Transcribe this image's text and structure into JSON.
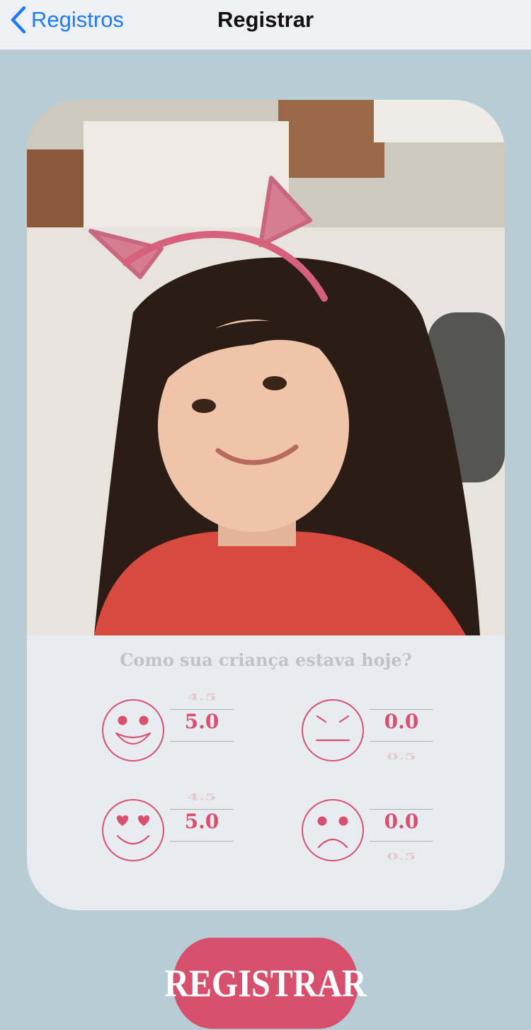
{
  "nav": {
    "back_label": "Registros",
    "title": "Registrar"
  },
  "card": {
    "question": "Como sua criança estava hoje?",
    "ratings": [
      {
        "mood": "happy",
        "above": "4.5",
        "value": "5.0",
        "below": ""
      },
      {
        "mood": "annoyed",
        "above": "",
        "value": "0.0",
        "below": "0.5"
      },
      {
        "mood": "in-love",
        "above": "4.5",
        "value": "5.0",
        "below": ""
      },
      {
        "mood": "sad",
        "above": "",
        "value": "0.0",
        "below": "0.5"
      }
    ]
  },
  "register_label": "REGISTRAR",
  "colors": {
    "accent": "#d6506e",
    "ios_blue": "#1f7bf5",
    "background": "#b7ccd4",
    "card": "#e8ecf0"
  }
}
